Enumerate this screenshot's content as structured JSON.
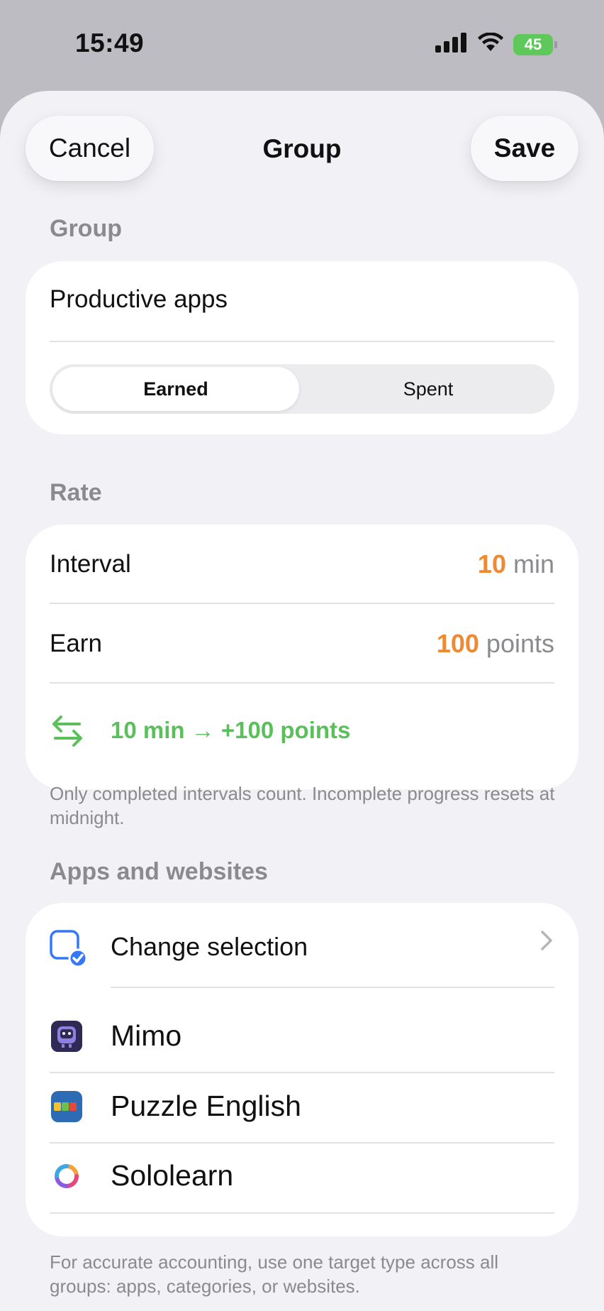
{
  "status_bar": {
    "time": "15:49",
    "battery": "45"
  },
  "header": {
    "cancel_label": "Cancel",
    "title": "Group",
    "save_label": "Save"
  },
  "group_section": {
    "label": "Group",
    "name_value": "Productive apps",
    "segments": [
      "Earned",
      "Spent"
    ],
    "selected_segment": "Earned"
  },
  "rate_section": {
    "label": "Rate",
    "interval_label": "Interval",
    "interval_value": "10",
    "interval_unit": "min",
    "earn_label": "Earn",
    "earn_value": "100",
    "earn_unit": "points",
    "summary": "10 min → +100 points",
    "footnote": "Only completed intervals count. Incomplete progress resets at midnight."
  },
  "apps_section": {
    "label": "Apps and websites",
    "change_selection_label": "Change selection",
    "apps": [
      {
        "name": "Mimo",
        "icon": "mimo-app-icon"
      },
      {
        "name": "Puzzle English",
        "icon": "puzzle-english-app-icon"
      },
      {
        "name": "Sololearn",
        "icon": "sololearn-app-icon"
      }
    ],
    "footnote": "For accurate accounting, use one target type across all groups: apps, categories, or websites."
  },
  "colors": {
    "accent_orange": "#ee8a34",
    "accent_green": "#5bc05b",
    "accent_blue": "#3478f6",
    "sheet_bg": "#f1f1f6"
  }
}
